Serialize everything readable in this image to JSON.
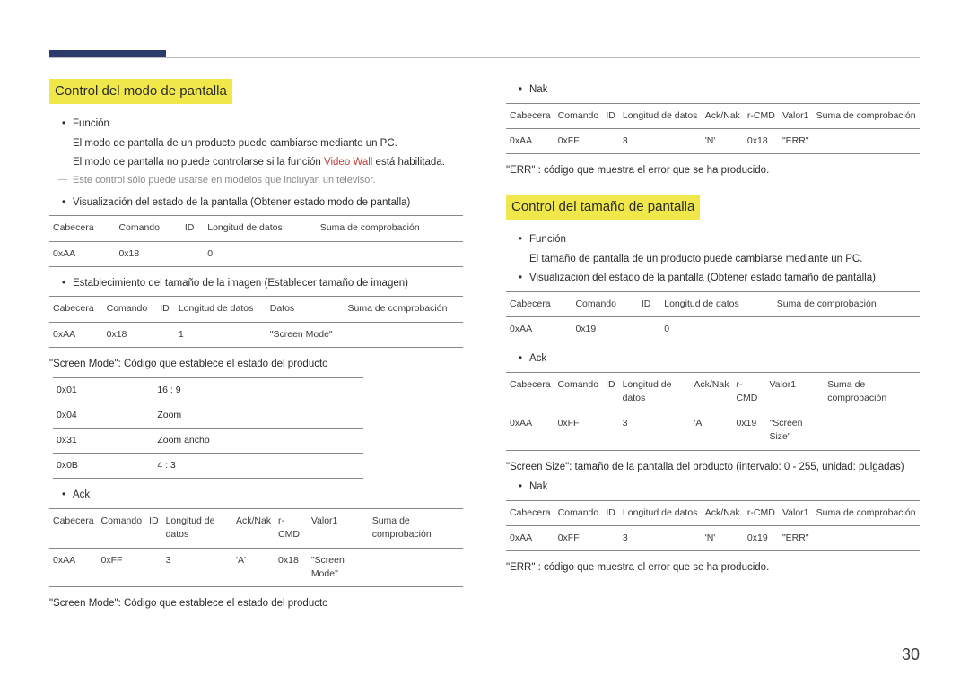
{
  "page_number": "30",
  "left": {
    "title": "Control del modo de pantalla",
    "b_function": "Función",
    "func_line1": "El modo de pantalla de un producto puede cambiarse mediante un PC.",
    "func_line2a": "El modo de pantalla no puede controlarse si la función ",
    "func_line2_red": "Video Wall",
    "func_line2b": " está habilitada.",
    "note": "Este control sólo puede usarse en modelos que incluyan un televisor.",
    "b_viz": "Visualización del estado de la pantalla (Obtener estado modo de pantalla)",
    "t1": {
      "h": [
        "Cabecera",
        "Comando",
        "ID",
        "Longitud de datos",
        "Suma de comprobación"
      ],
      "r": [
        "0xAA",
        "0x18",
        "",
        "0",
        ""
      ]
    },
    "b_set": "Establecimiento del tamaño de la imagen (Establecer tamaño de imagen)",
    "t2": {
      "h": [
        "Cabecera",
        "Comando",
        "ID",
        "Longitud de datos",
        "Datos",
        "Suma de comprobación"
      ],
      "r": [
        "0xAA",
        "0x18",
        "",
        "1",
        "\"Screen Mode\"",
        ""
      ]
    },
    "desc1": "\"Screen Mode\": Código que establece el estado del producto",
    "codes": [
      [
        "0x01",
        "16 : 9"
      ],
      [
        "0x04",
        "Zoom"
      ],
      [
        "0x31",
        "Zoom ancho"
      ],
      [
        "0x0B",
        "4 : 3"
      ]
    ],
    "b_ack": "Ack",
    "t3": {
      "h": [
        "Cabecera",
        "Comando",
        "ID",
        "Longitud de datos",
        "Ack/Nak",
        "r-CMD",
        "Valor1",
        "Suma de comprobación"
      ],
      "r": [
        "0xAA",
        "0xFF",
        "",
        "3",
        "'A'",
        "0x18",
        "\"Screen Mode\"",
        ""
      ]
    },
    "desc2": "\"Screen Mode\": Código que establece el estado del producto"
  },
  "right": {
    "b_nak": "Nak",
    "t_nak": {
      "h": [
        "Cabecera",
        "Comando",
        "ID",
        "Longitud de datos",
        "Ack/Nak",
        "r-CMD",
        "Valor1",
        "Suma de comprobación"
      ],
      "r": [
        "0xAA",
        "0xFF",
        "",
        "3",
        "'N'",
        "0x18",
        "\"ERR\"",
        ""
      ]
    },
    "err_text": "\"ERR\" : código que muestra el error que se ha producido.",
    "title2": "Control del tamaño de pantalla",
    "b_function2": "Función",
    "func2_line": "El tamaño de pantalla de un producto puede cambiarse mediante un PC.",
    "b_viz2": "Visualización del estado de la pantalla (Obtener estado tamaño de pantalla)",
    "t_viz2": {
      "h": [
        "Cabecera",
        "Comando",
        "ID",
        "Longitud de datos",
        "Suma de comprobación"
      ],
      "r": [
        "0xAA",
        "0x19",
        "",
        "0",
        ""
      ]
    },
    "b_ack2": "Ack",
    "t_ack2": {
      "h": [
        "Cabecera",
        "Comando",
        "ID",
        "Longitud de datos",
        "Ack/Nak",
        "r-CMD",
        "Valor1",
        "Suma de comprobación"
      ],
      "r": [
        "0xAA",
        "0xFF",
        "",
        "3",
        "'A'",
        "0x19",
        "\"Screen Size\"",
        ""
      ]
    },
    "size_desc": "\"Screen Size\": tamaño de la pantalla del producto (intervalo: 0 - 255, unidad: pulgadas)",
    "b_nak2": "Nak",
    "t_nak2": {
      "h": [
        "Cabecera",
        "Comando",
        "ID",
        "Longitud de datos",
        "Ack/Nak",
        "r-CMD",
        "Valor1",
        "Suma de comprobación"
      ],
      "r": [
        "0xAA",
        "0xFF",
        "",
        "3",
        "'N'",
        "0x19",
        "\"ERR\"",
        ""
      ]
    },
    "err_text2": "\"ERR\" : código que muestra el error que se ha producido."
  }
}
